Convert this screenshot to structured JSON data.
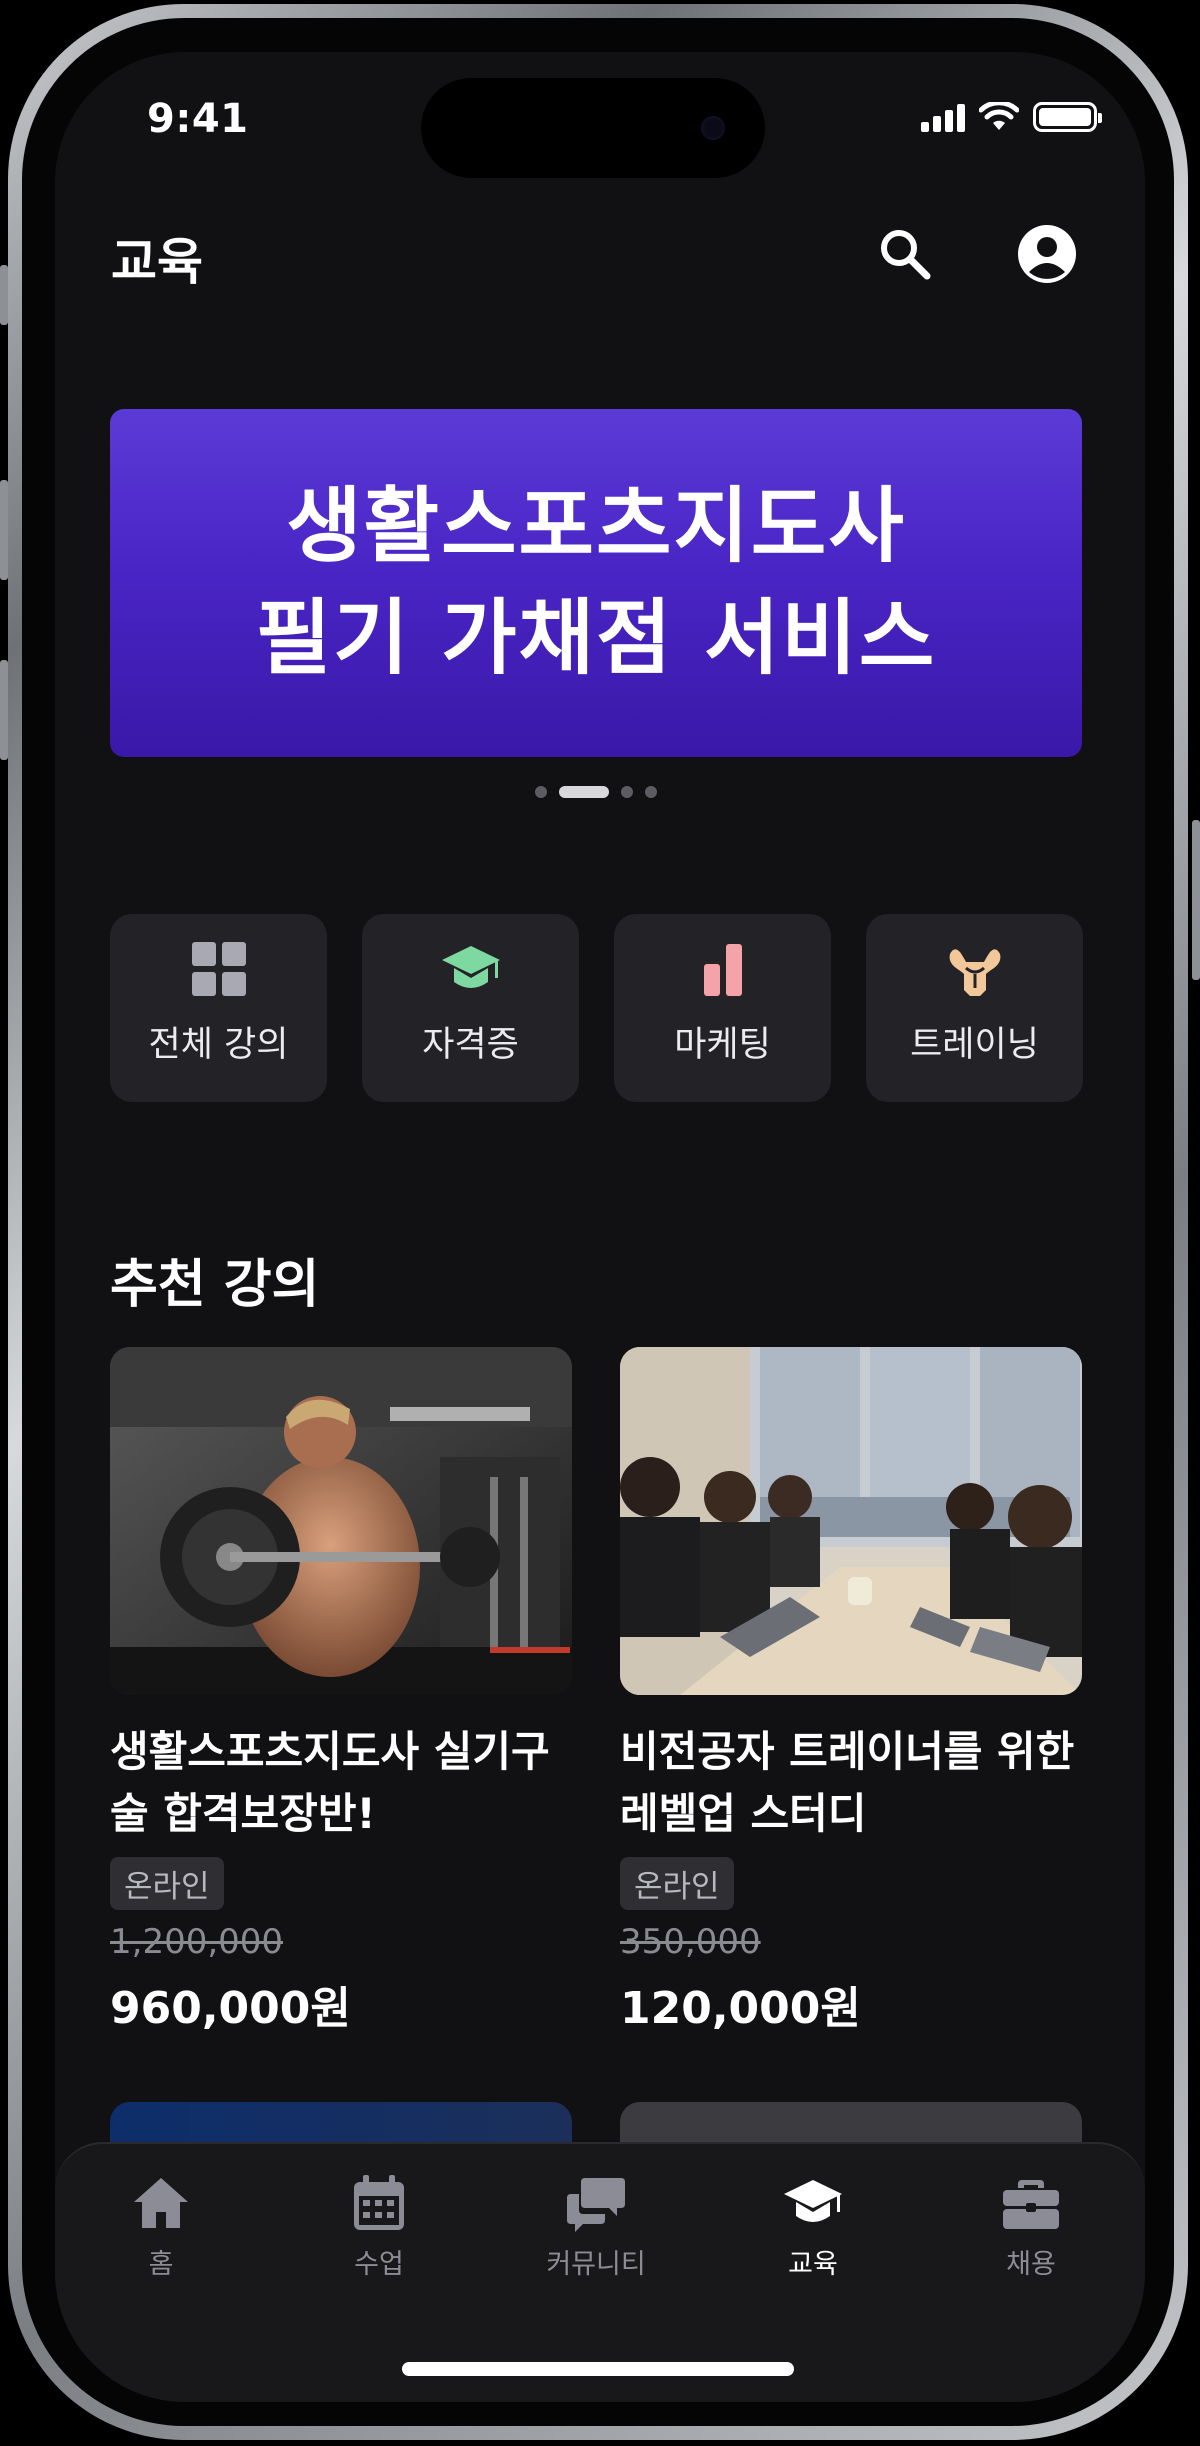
{
  "status_bar": {
    "time": "9:41"
  },
  "header": {
    "title": "교육"
  },
  "banner": {
    "line1": "생활스포츠지도사",
    "line2": "필기 가채점 서비스",
    "slide_count": 4,
    "active_slide": 2
  },
  "categories": [
    {
      "label": "전체 강의",
      "icon": "grid-icon",
      "color": "#a9a9b3"
    },
    {
      "label": "자격증",
      "icon": "graduation-cap-icon",
      "color": "#7ed9a0"
    },
    {
      "label": "마케팅",
      "icon": "bar-chart-icon",
      "color": "#f4a3a8"
    },
    {
      "label": "트레이닝",
      "icon": "muscle-icon",
      "color": "#f2c79a"
    }
  ],
  "section": {
    "title": "추천 강의"
  },
  "courses": [
    {
      "title": "생활스포츠지도사 실기구술 합격보장반!",
      "badge": "온라인",
      "original_price": "1,200,000",
      "price": "960,000원",
      "image": "gym-trainer-photo"
    },
    {
      "title": "비전공자 트레이너를 위한 레벨업 스터디",
      "badge": "온라인",
      "original_price": "350,000",
      "price": "120,000원",
      "image": "study-group-photo"
    }
  ],
  "tabbar": {
    "items": [
      {
        "label": "홈",
        "icon": "home-icon"
      },
      {
        "label": "수업",
        "icon": "calendar-icon"
      },
      {
        "label": "커뮤니티",
        "icon": "chat-icon"
      },
      {
        "label": "교육",
        "icon": "graduation-cap-icon"
      },
      {
        "label": "채용",
        "icon": "briefcase-icon"
      }
    ],
    "active": "교육"
  },
  "colors": {
    "accent": "#4a25c6",
    "background": "#111113",
    "card": "#232327"
  }
}
